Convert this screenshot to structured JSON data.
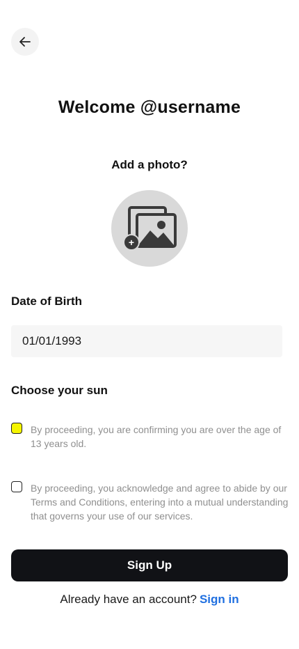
{
  "header": {
    "back_icon": "arrow-left-icon"
  },
  "title": "Welcome @username",
  "photo": {
    "label": "Add a photo?",
    "icon": "photo-stack-icon",
    "badge": "+"
  },
  "dob": {
    "label": "Date of Birth",
    "value": "01/01/1993"
  },
  "sun": {
    "label": "Choose your sun"
  },
  "consents": [
    {
      "checked": true,
      "checkbox_color": "#f5f500",
      "text": "By proceeding, you are confirming you are over the age of 13 years old."
    },
    {
      "checked": false,
      "text": "By proceeding, you acknowledge and agree to abide by our Terms and Conditions, entering into a mutual understanding that governs your use of our services."
    }
  ],
  "signup": {
    "label": "Sign Up"
  },
  "signin": {
    "prompt": "Already have an account?",
    "link": "Sign in",
    "link_color": "#1f6fe0"
  }
}
